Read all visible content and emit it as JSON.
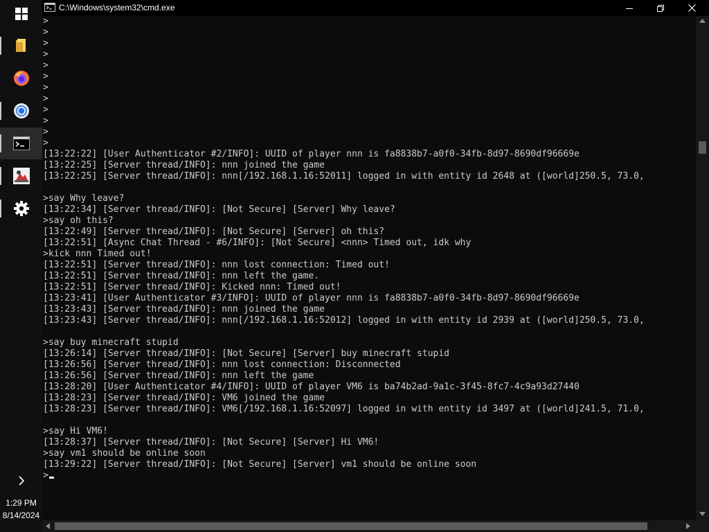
{
  "window": {
    "title": "C:\\Windows\\system32\\cmd.exe",
    "icon": "cmd-icon"
  },
  "taskbar": {
    "items": [
      {
        "name": "start",
        "icon": "windows-logo-icon"
      },
      {
        "name": "file-explorer",
        "icon": "folder-icon"
      },
      {
        "name": "firefox",
        "icon": "firefox-icon"
      },
      {
        "name": "chrome",
        "icon": "chrome-icon"
      },
      {
        "name": "command-prompt",
        "icon": "cmd-icon",
        "active": true
      },
      {
        "name": "app",
        "icon": "app-icon"
      },
      {
        "name": "settings",
        "icon": "gear-icon"
      }
    ],
    "overflow_icon": "chevron-right-icon",
    "clock": {
      "time": "1:29 PM",
      "date": "8/14/2024"
    }
  },
  "console": {
    "lines": [
      ">",
      ">",
      ">",
      ">",
      ">",
      ">",
      ">",
      ">",
      ">",
      ">",
      ">",
      ">",
      "[13:22:22] [User Authenticator #2/INFO]: UUID of player nnn is fa8838b7-a0f0-34fb-8d97-8690df96669e",
      "[13:22:25] [Server thread/INFO]: nnn joined the game",
      "[13:22:25] [Server thread/INFO]: nnn[/192.168.1.16:52011] logged in with entity id 2648 at ([world]250.5, 73.0,",
      "",
      ">say Why leave?",
      "[13:22:34] [Server thread/INFO]: [Not Secure] [Server] Why leave?",
      ">say oh this?",
      "[13:22:49] [Server thread/INFO]: [Not Secure] [Server] oh this?",
      "[13:22:51] [Async Chat Thread - #6/INFO]: [Not Secure] <nnn> Timed out, idk why",
      ">kick nnn Timed out!",
      "[13:22:51] [Server thread/INFO]: nnn lost connection: Timed out!",
      "[13:22:51] [Server thread/INFO]: nnn left the game.",
      "[13:22:51] [Server thread/INFO]: Kicked nnn: Timed out!",
      "[13:23:41] [User Authenticator #3/INFO]: UUID of player nnn is fa8838b7-a0f0-34fb-8d97-8690df96669e",
      "[13:23:43] [Server thread/INFO]: nnn joined the game",
      "[13:23:43] [Server thread/INFO]: nnn[/192.168.1.16:52012] logged in with entity id 2939 at ([world]250.5, 73.0,",
      "",
      ">say buy minecraft stupid",
      "[13:26:14] [Server thread/INFO]: [Not Secure] [Server] buy minecraft stupid",
      "[13:26:56] [Server thread/INFO]: nnn lost connection: Disconnected",
      "[13:26:56] [Server thread/INFO]: nnn left the game",
      "[13:28:20] [User Authenticator #4/INFO]: UUID of player VM6 is ba74b2ad-9a1c-3f45-8fc7-4c9a93d27440",
      "[13:28:23] [Server thread/INFO]: VM6 joined the game",
      "[13:28:23] [Server thread/INFO]: VM6[/192.168.1.16:52097] logged in with entity id 3497 at ([world]241.5, 71.0,",
      "",
      ">say Hi VM6!",
      "[13:28:37] [Server thread/INFO]: [Not Secure] [Server] Hi VM6!",
      ">say vm1 should be online soon",
      "[13:29:22] [Server thread/INFO]: [Not Secure] [Server] vm1 should be online soon"
    ],
    "prompt": ">"
  },
  "colors": {
    "console_bg": "#0c0c0c",
    "console_text": "#cccccc",
    "taskbar_bg": "#101010",
    "titlebar_bg": "#000000"
  }
}
